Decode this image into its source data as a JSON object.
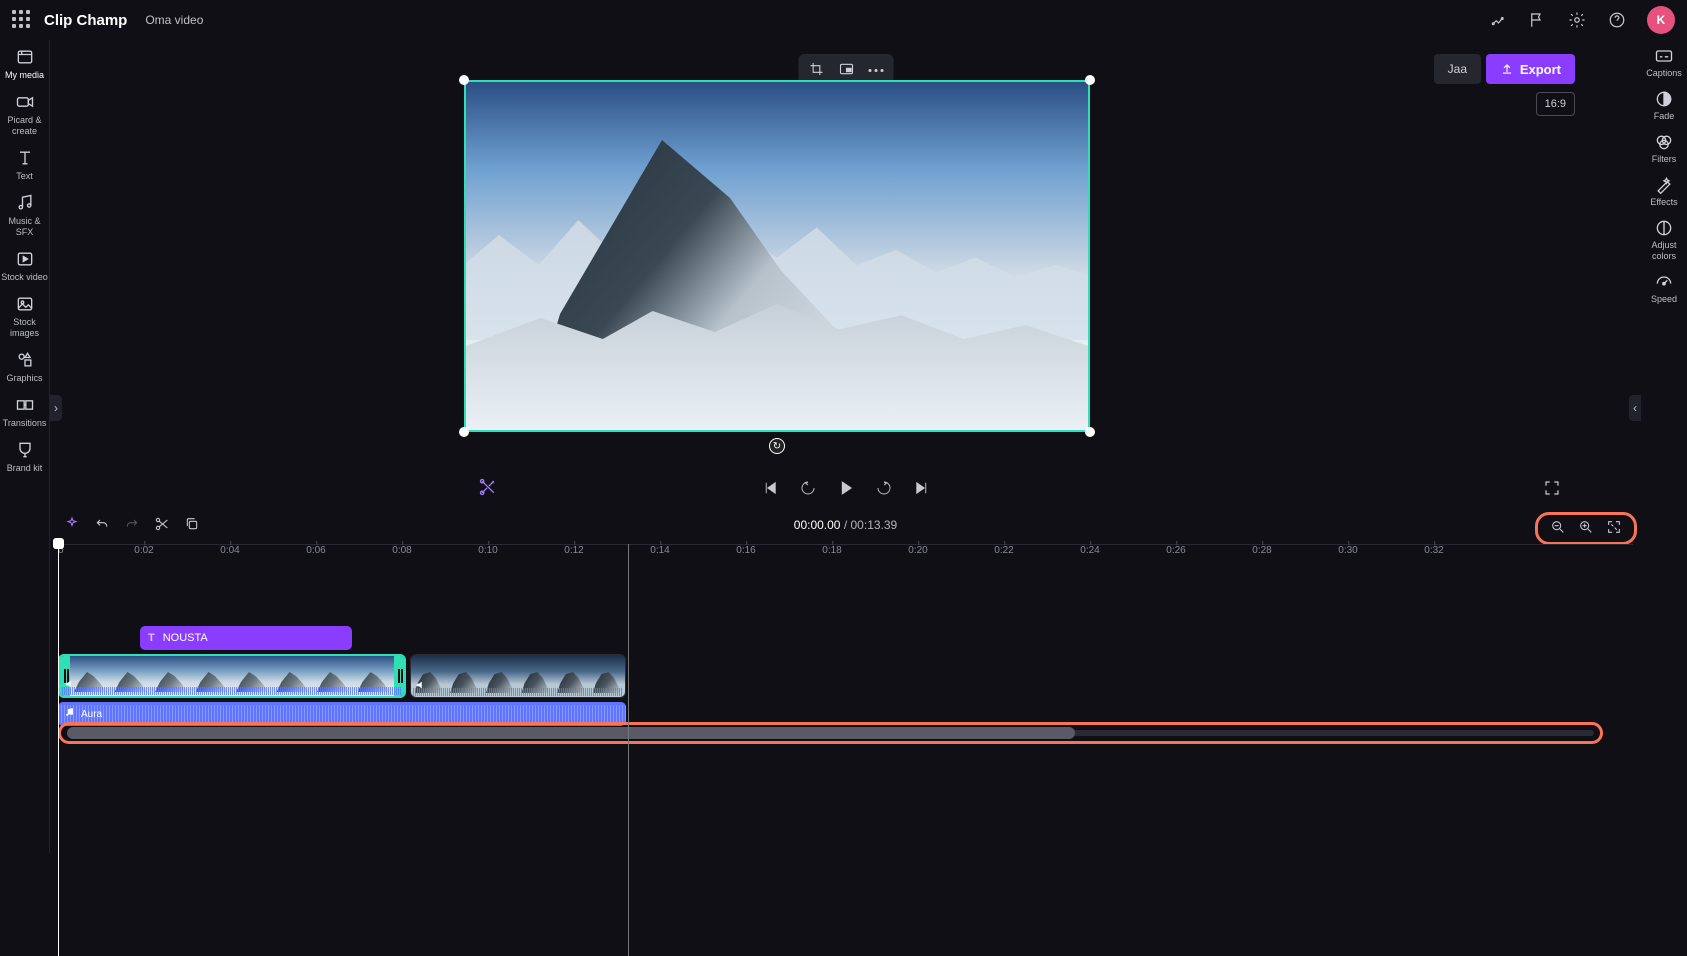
{
  "header": {
    "brand": "Clip Champ",
    "project": "Oma video",
    "avatar_initial": "K",
    "share_label": "Jaa",
    "export_label": "Export",
    "aspect_ratio": "16:9"
  },
  "left_sidebar": {
    "items": [
      {
        "id": "my-media",
        "label": "My media"
      },
      {
        "id": "record",
        "label": "Picard & create"
      },
      {
        "id": "text",
        "label": "Text"
      },
      {
        "id": "music",
        "label": "Music & SFX"
      },
      {
        "id": "stock-video",
        "label": "Stock video"
      },
      {
        "id": "stock-images",
        "label": "Stock images"
      },
      {
        "id": "graphics",
        "label": "Graphics"
      },
      {
        "id": "transitions",
        "label": "Transitions"
      },
      {
        "id": "brand-kit",
        "label": "Brand kit"
      }
    ]
  },
  "right_sidebar": {
    "items": [
      {
        "id": "captions",
        "label": "Captions"
      },
      {
        "id": "fade",
        "label": "Fade"
      },
      {
        "id": "filters",
        "label": "Filters"
      },
      {
        "id": "effects",
        "label": "Effects"
      },
      {
        "id": "adjust",
        "label": "Adjust colors"
      },
      {
        "id": "speed",
        "label": "Speed"
      }
    ]
  },
  "timeline": {
    "current_time": "00:00.00",
    "total_time": "00:13.39",
    "ruler_ticks": [
      "0",
      "0:02",
      "0:04",
      "0:06",
      "0:08",
      "0:10",
      "0:12",
      "0:14",
      "0:16",
      "0:18",
      "0:20",
      "0:22",
      "0:24",
      "0:26",
      "0:28",
      "0:30",
      "0:32"
    ],
    "text_clip_label": "NOUSTA",
    "audio_clip_label": "Aura"
  },
  "highlights": {
    "zoom_controls": true,
    "scrollbar": true
  }
}
